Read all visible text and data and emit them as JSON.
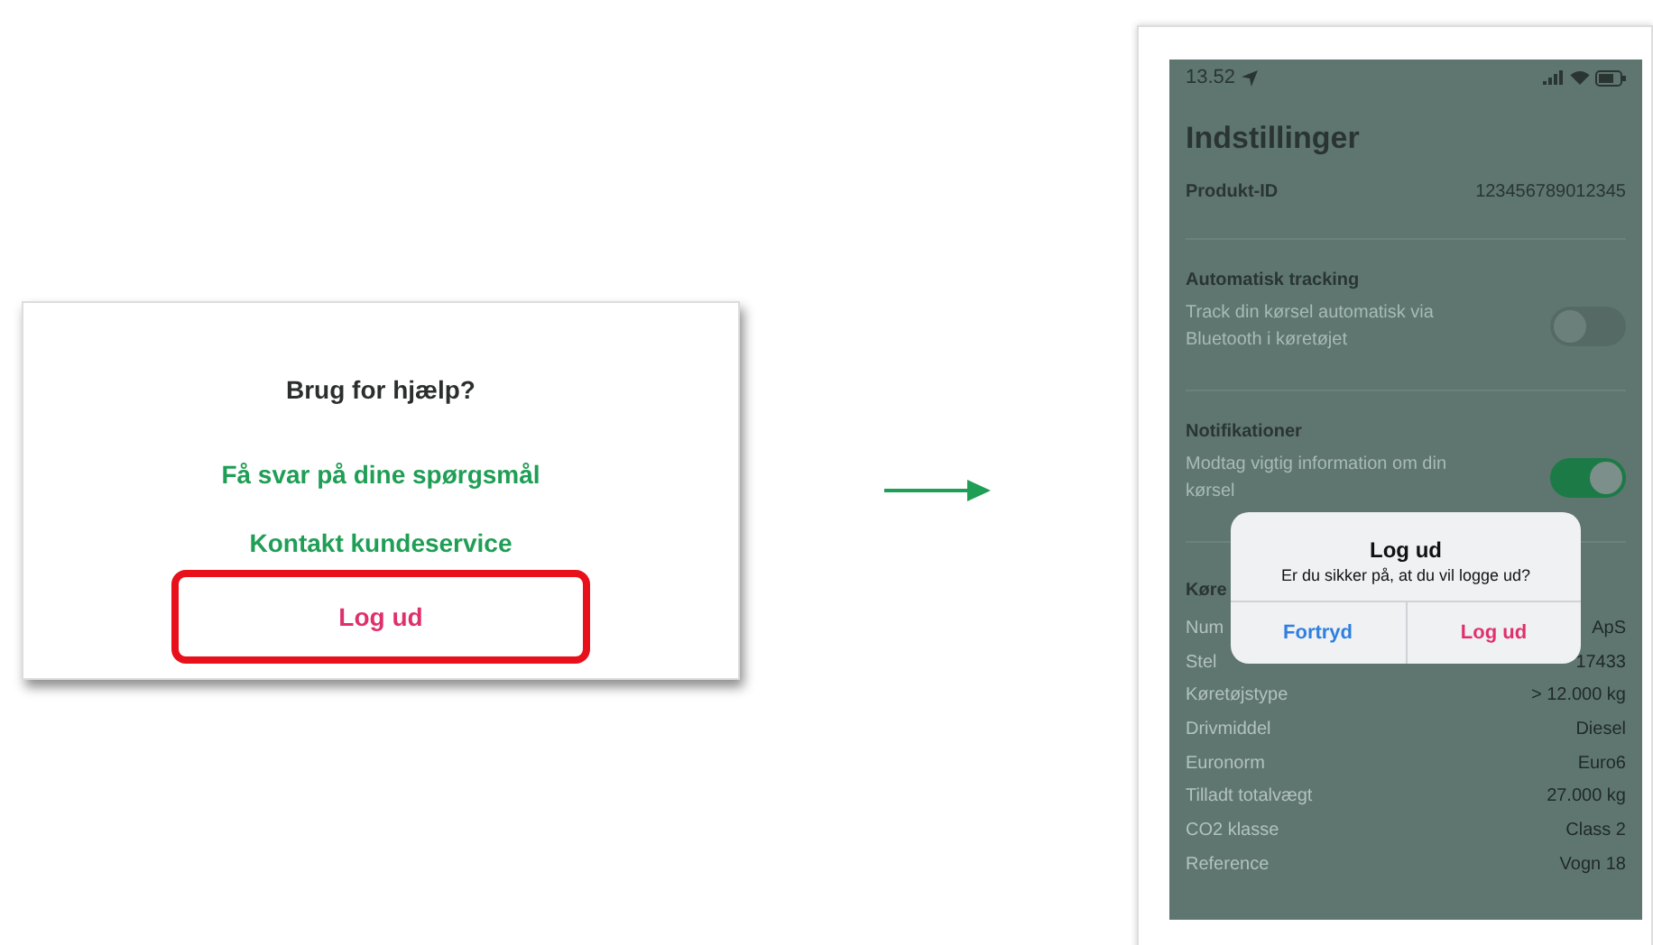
{
  "help_card": {
    "title": "Brug for hjælp?",
    "links": [
      {
        "label": "Få svar på dine spørgsmål",
        "kind": "link",
        "highlighted": false
      },
      {
        "label": "Kontakt kundeservice",
        "kind": "link",
        "highlighted": false
      },
      {
        "label": "Log ud",
        "kind": "logout",
        "highlighted": true
      }
    ]
  },
  "phone": {
    "status_bar": {
      "time": "13.52"
    },
    "title": "Indstillinger",
    "product": {
      "label": "Produkt-ID",
      "value": "123456789012345"
    },
    "settings": [
      {
        "title": "Automatisk tracking",
        "description": "Track din kørsel automatisk via Bluetooth i køretøjet",
        "on": false
      },
      {
        "title": "Notifikationer",
        "description": "Modtag vigtig information om din kørsel",
        "on": true
      }
    ],
    "vehicle": {
      "title": "Køre",
      "rows": [
        {
          "label": "Num",
          "value": "ApS"
        },
        {
          "label": "Stel",
          "value": "17433"
        },
        {
          "label": "Køretøjstype",
          "value": "> 12.000 kg"
        },
        {
          "label": "Drivmiddel",
          "value": "Diesel"
        },
        {
          "label": "Euronorm",
          "value": "Euro6"
        },
        {
          "label": "Tilladt totalvægt",
          "value": "27.000 kg"
        },
        {
          "label": "CO2 klasse",
          "value": "Class 2"
        },
        {
          "label": "Reference",
          "value": "Vogn 18"
        }
      ]
    },
    "dialog": {
      "title": "Log ud",
      "message": "Er du sikker på, at du vil logge ud?",
      "buttons": [
        {
          "label": "Fortryd",
          "kind": "cancel"
        },
        {
          "label": "Log ud",
          "kind": "destructive"
        }
      ]
    }
  }
}
